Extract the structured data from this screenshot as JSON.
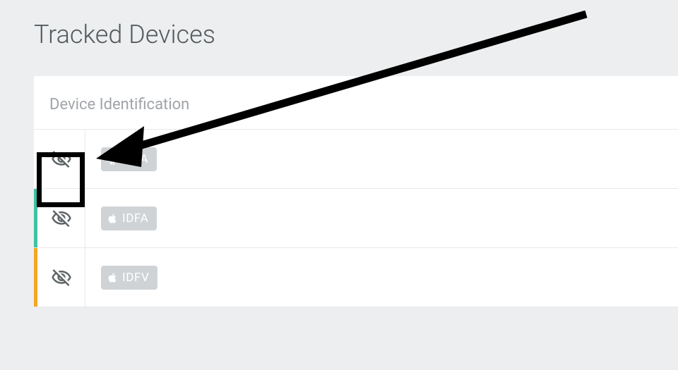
{
  "page": {
    "title": "Tracked Devices"
  },
  "panel": {
    "header": "Device Identification"
  },
  "rows": [
    {
      "accent": "none",
      "platform": "android",
      "tag_label": "AIFA"
    },
    {
      "accent": "teal",
      "platform": "apple",
      "tag_label": "IDFA"
    },
    {
      "accent": "orange",
      "platform": "apple",
      "tag_label": "IDFV"
    }
  ],
  "annotation": {
    "highlight_row_index": 0
  }
}
